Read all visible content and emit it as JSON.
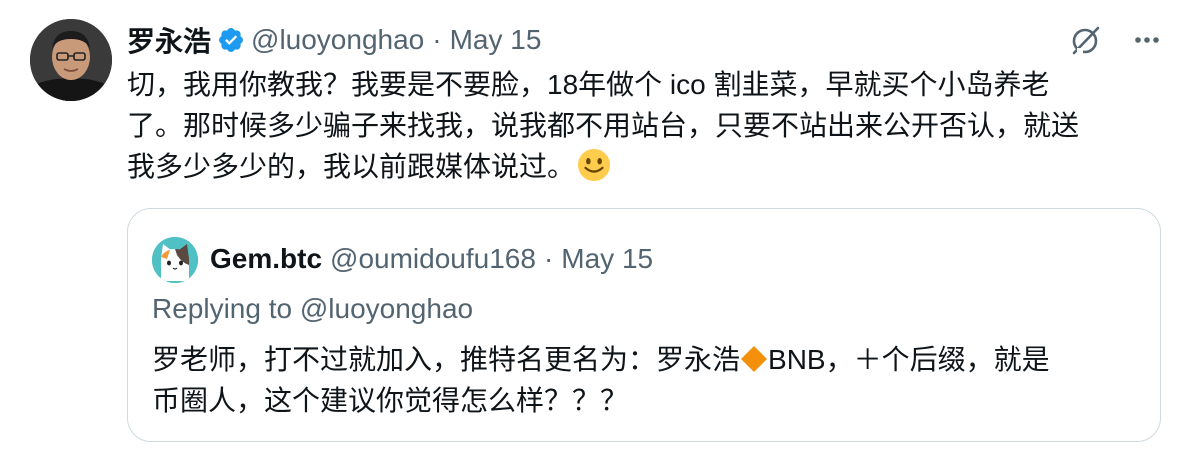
{
  "tweet": {
    "author_name": "罗永浩",
    "author_handle": "@luoyonghao",
    "separator": "·",
    "date": "May 15",
    "text_before_emoji": "切，我用你教我？我要是不要脸，18年做个 ico 割韭菜，早就买个小岛养老\n了。那时候多少骗子来找我，说我都不用站台，只要不站出来公开否认，就送\n我多少多少的，我以前跟媒体说过。",
    "emoji": "slightly-smiling-face"
  },
  "icons": {
    "verified": "verified-badge-icon",
    "grok": "grok-icon",
    "more": "more-icon",
    "bnb": "orange-diamond-icon"
  },
  "colors": {
    "verified_blue": "#1d9bf0",
    "secondary_text": "#536471",
    "border": "#cfd9de",
    "diamond_orange": "#f4900c"
  },
  "quote": {
    "author_name": "Gem.btc",
    "author_handle": "@oumidoufu168",
    "separator": "·",
    "date": "May 15",
    "replying_to": "Replying to @luoyonghao",
    "text_before_diamond": "罗老师，打不过就加入，推特名更名为：罗永浩",
    "text_after_diamond": "BNB，＋个后缀，就是\n币圈人，这个建议你觉得怎么样？？？"
  }
}
